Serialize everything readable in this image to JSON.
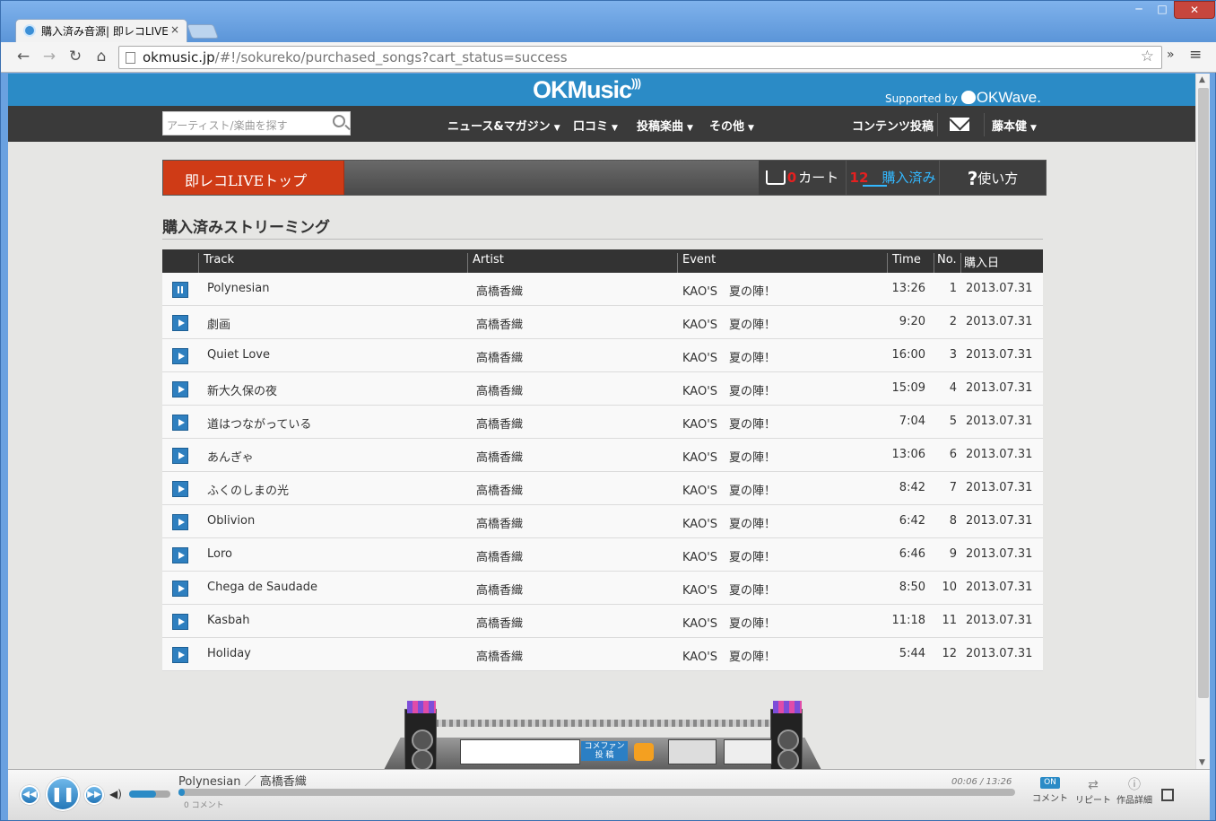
{
  "browser": {
    "tab_title": "購入済み音源| 即レコLIVE",
    "tab_close": "×",
    "url_host": "okmusic.jp",
    "url_path": "/#!/sokureko/purchased_songs?cart_status=success",
    "window_min": "─",
    "window_max": "□",
    "window_close": "✕"
  },
  "site": {
    "logo": "OKMusic",
    "supported_by": "Supported by",
    "partner": "OKWave."
  },
  "menu": {
    "search_placeholder": "アーティスト/楽曲を探す",
    "items": [
      "ニュース&マガジン",
      "口コミ",
      "投稿楽曲",
      "その他"
    ],
    "post": "コンテンツ投稿",
    "user": "藤本健"
  },
  "subnav": {
    "top_label": "即レコLIVEトップ",
    "cart_count": "0",
    "cart_label": "カート",
    "purchased_count": "12",
    "purchased_label": "購入済み",
    "help_q": "?",
    "help_label": "使い方"
  },
  "page_title": "購入済みストリーミング",
  "table": {
    "headers": {
      "track": "Track",
      "artist": "Artist",
      "event": "Event",
      "time": "Time",
      "no": "No.",
      "date": "購入日"
    },
    "rows": [
      {
        "track": "Polynesian",
        "artist": "高橋香織",
        "event": "KAO'S　夏の陣！",
        "time": "13:26",
        "no": "1",
        "date": "2013.07.31"
      },
      {
        "track": "劇画",
        "artist": "高橋香織",
        "event": "KAO'S　夏の陣！",
        "time": "9:20",
        "no": "2",
        "date": "2013.07.31"
      },
      {
        "track": "Quiet Love",
        "artist": "高橋香織",
        "event": "KAO'S　夏の陣！",
        "time": "16:00",
        "no": "3",
        "date": "2013.07.31"
      },
      {
        "track": "新大久保の夜",
        "artist": "高橋香織",
        "event": "KAO'S　夏の陣！",
        "time": "15:09",
        "no": "4",
        "date": "2013.07.31"
      },
      {
        "track": "道はつながっている",
        "artist": "高橋香織",
        "event": "KAO'S　夏の陣！",
        "time": "7:04",
        "no": "5",
        "date": "2013.07.31"
      },
      {
        "track": "あんぎゃ",
        "artist": "高橋香織",
        "event": "KAO'S　夏の陣！",
        "time": "13:06",
        "no": "6",
        "date": "2013.07.31"
      },
      {
        "track": "ふくのしまの光",
        "artist": "高橋香織",
        "event": "KAO'S　夏の陣！",
        "time": "8:42",
        "no": "7",
        "date": "2013.07.31"
      },
      {
        "track": "Oblivion",
        "artist": "高橋香織",
        "event": "KAO'S　夏の陣！",
        "time": "6:42",
        "no": "8",
        "date": "2013.07.31"
      },
      {
        "track": "Loro",
        "artist": "高橋香織",
        "event": "KAO'S　夏の陣！",
        "time": "6:46",
        "no": "9",
        "date": "2013.07.31"
      },
      {
        "track": "Chega de Saudade",
        "artist": "高橋香織",
        "event": "KAO'S　夏の陣！",
        "time": "8:50",
        "no": "10",
        "date": "2013.07.31"
      },
      {
        "track": "Kasbah",
        "artist": "高橋香織",
        "event": "KAO'S　夏の陣！",
        "time": "11:18",
        "no": "11",
        "date": "2013.07.31"
      },
      {
        "track": "Holiday",
        "artist": "高橋香織",
        "event": "KAO'S　夏の陣！",
        "time": "5:44",
        "no": "12",
        "date": "2013.07.31"
      }
    ]
  },
  "stage": {
    "comfan_line1": "コメファン",
    "comfan_line2": "投 稿"
  },
  "player": {
    "now_playing": "Polynesian ／ 高橋香織",
    "time": "00:06 / 13:26",
    "progress": 0.0074,
    "volume": 0.65,
    "comments": "0 コメント",
    "on_badge": "ON",
    "comment_label": "コメント",
    "repeat_label": "リピート",
    "detail_label": "作品詳細"
  },
  "colors": {
    "header_blue": "#2b8bc6",
    "menu_dark": "#3a3a3a",
    "accent_red": "#cf3b16",
    "play_blue": "#2e7fbf"
  }
}
